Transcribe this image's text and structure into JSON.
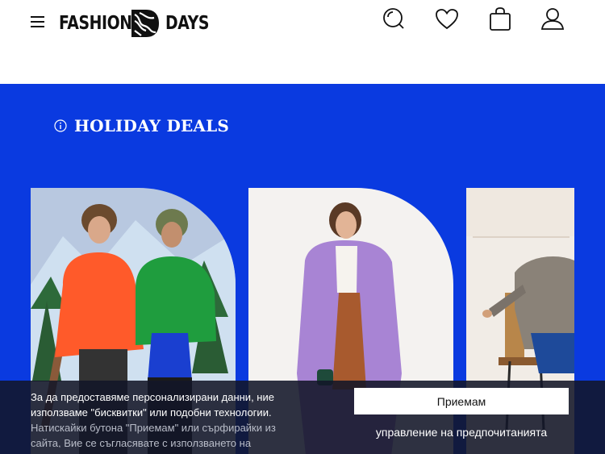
{
  "header": {
    "logo_left": "FASHION",
    "logo_right": "DAYS",
    "icons": [
      "menu-icon",
      "search-icon",
      "heart-icon",
      "bag-icon",
      "user-icon"
    ]
  },
  "hero": {
    "title": "HOLIDAY DEALS",
    "background_color": "#0a3ae0",
    "cards": [
      {
        "id": "winter-jackets"
      },
      {
        "id": "purple-coat"
      },
      {
        "id": "plaid-blazer"
      }
    ]
  },
  "cookie_banner": {
    "text_line1": "За да предоставяме персонализирани данни, ние",
    "text_line2": "използваме \"бисквитки\" или подобни технологии.",
    "text_line3": "Натискайки бутона \"Приемам\" или сърфирайки из",
    "text_line4": "сайта, Вие се съгласявате с използването на",
    "accept_label": "Приемам",
    "preferences_label": "управление на предпочитанията"
  }
}
